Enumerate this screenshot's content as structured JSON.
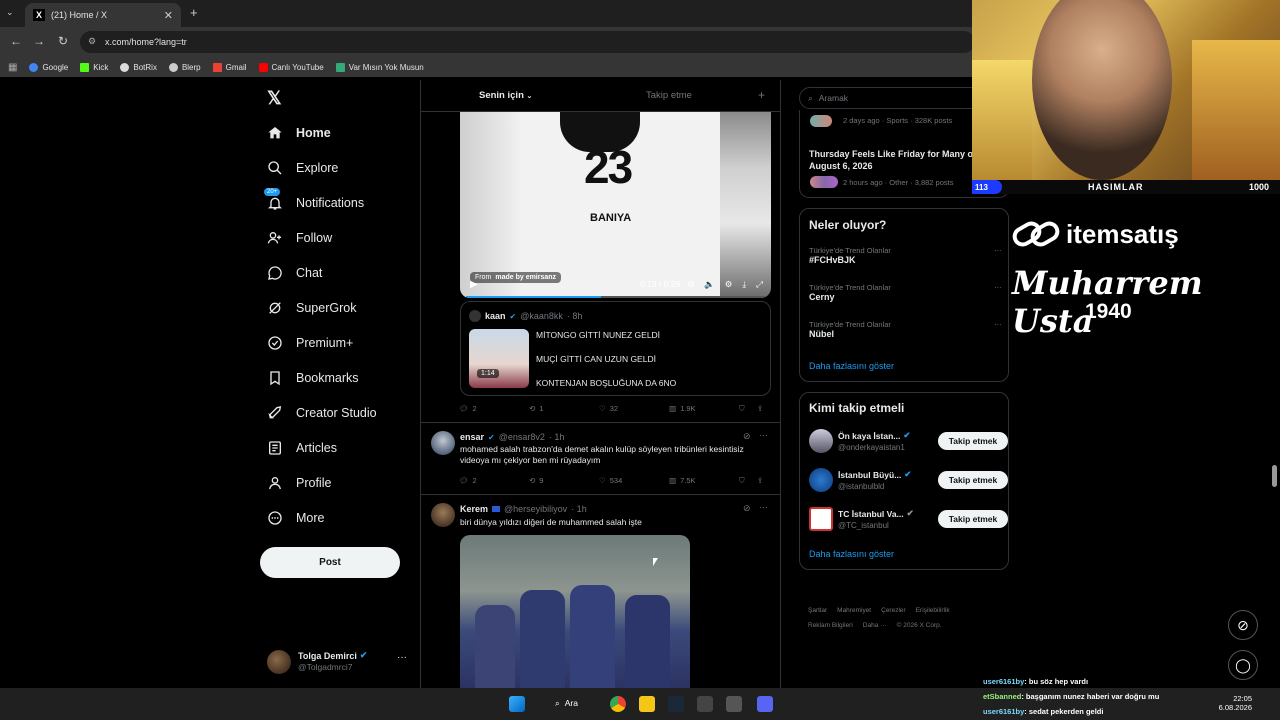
{
  "browser": {
    "tab_title": "(21) Home / X",
    "url": "x.com/home?lang=tr",
    "bookmarks": [
      "Google",
      "Kick",
      "BotRix",
      "Blerp",
      "Gmail",
      "Canlı YouTube",
      "Var Mısın Yok Musun"
    ]
  },
  "sidebar": {
    "items": [
      {
        "label": "Home",
        "icon": "home-icon"
      },
      {
        "label": "Explore",
        "icon": "search-icon"
      },
      {
        "label": "Notifications",
        "icon": "bell-icon",
        "badge": "20+"
      },
      {
        "label": "Follow",
        "icon": "person-add-icon"
      },
      {
        "label": "Chat",
        "icon": "chat-icon"
      },
      {
        "label": "SuperGrok",
        "icon": "grok-icon"
      },
      {
        "label": "Premium+",
        "icon": "premium-icon"
      },
      {
        "label": "Bookmarks",
        "icon": "bookmark-icon"
      },
      {
        "label": "Creator Studio",
        "icon": "rocket-icon"
      },
      {
        "label": "Articles",
        "icon": "article-icon"
      },
      {
        "label": "Profile",
        "icon": "person-icon"
      },
      {
        "label": "More",
        "icon": "more-circle-icon"
      }
    ],
    "post_label": "Post",
    "account_name": "Tolga Demirci",
    "account_handle": "@Tolgadmrci7"
  },
  "feed": {
    "tab_for_you": "Senin için",
    "tab_following": "Takip etme",
    "video": {
      "time": "0:13 / 0:29",
      "jersey_number": "23",
      "jersey_name": "BANIYA",
      "from_label": "From",
      "from_source": "made by emirsanz"
    },
    "quoted": {
      "name": "kaan",
      "handle": "@kaan8kk",
      "time": "· 8h",
      "lines": [
        "MİTONGO GİTTİ NUNEZ GELDİ",
        "MUÇİ GİTTİ CAN UZUN GELDİ",
        "KONTENJAN BOŞLUĞUNA DA 6NO"
      ],
      "thumb_duration": "1:14"
    },
    "actions1": {
      "replies": "2",
      "reposts": "1",
      "likes": "32",
      "views": "1.9K"
    },
    "tweet2": {
      "name": "ensar",
      "handle": "@ensar8v2",
      "time": "· 1h",
      "text": "mohamed salah trabzon'da demet akalın kulüp söyleyen tribünleri kesintisiz videoya mı çekiyor ben mi rüyadayım",
      "replies": "2",
      "reposts": "9",
      "likes": "534",
      "views": "7.5K"
    },
    "tweet3": {
      "name": "Kerem",
      "handle": "@herseyibiliyov",
      "time": "· 1h",
      "text": "biri dünya yıldızı diğeri de muhammed salah işte"
    }
  },
  "right": {
    "search_placeholder": "Aramak",
    "top_trends": [
      {
        "meta": "2 days ago · Sports · 328K posts"
      },
      {
        "title": "Thursday Feels Like Friday for Many on August 6, 2026",
        "meta": "2 hours ago · Other · 3,882 posts"
      }
    ],
    "happening_title": "Neler oluyor?",
    "trends": [
      {
        "context": "Türkiye'de Trend Olanlar",
        "name": "#FCHvBJK"
      },
      {
        "context": "Türkiye'de Trend Olanlar",
        "name": "Cerny"
      },
      {
        "context": "Türkiye'de Trend Olanlar",
        "name": "Nübel"
      }
    ],
    "show_more": "Daha fazlasını göster",
    "who_to_follow_title": "Kimi takip etmeli",
    "follow": [
      {
        "name": "Ön kaya İstan...",
        "handle": "@onderkayaistan1",
        "button": "Takip etmek"
      },
      {
        "name": "İstanbul Büyü...",
        "handle": "@istanbulbld",
        "button": "Takip etmek"
      },
      {
        "name": "TC İstanbul Va...",
        "handle": "@TC_istanbul",
        "button": "Takip etmek"
      }
    ],
    "footer_row1": [
      "Şartlar",
      "Mahremiyet",
      "Çerezler",
      "Erişilebilirlik"
    ],
    "footer_row2": [
      "Reklam Bilgileri",
      "Daha ···",
      "© 2026 X Corp."
    ]
  },
  "overlay": {
    "hasimlar_left": "113",
    "hasimlar_title": "HASIMLAR",
    "hasimlar_right": "1000",
    "brand": "itemsatış",
    "signature": "Muharrem Usta",
    "year": "1940"
  },
  "stream_chat": [
    {
      "user": "user6161by",
      "text": ": bu söz hep vardı"
    },
    {
      "user": "etSbanned",
      "text": ": başganım nunez haberi var doğru mu"
    },
    {
      "user": "user6161by",
      "text": ": sedat pekerden geldi"
    }
  ],
  "taskbar": {
    "search": "Ara",
    "time": "22:05",
    "date": "6.08.2026"
  },
  "colors": {
    "accent": "#1d9bf0",
    "verified": "#1d9bf0",
    "bg": "#000000"
  }
}
